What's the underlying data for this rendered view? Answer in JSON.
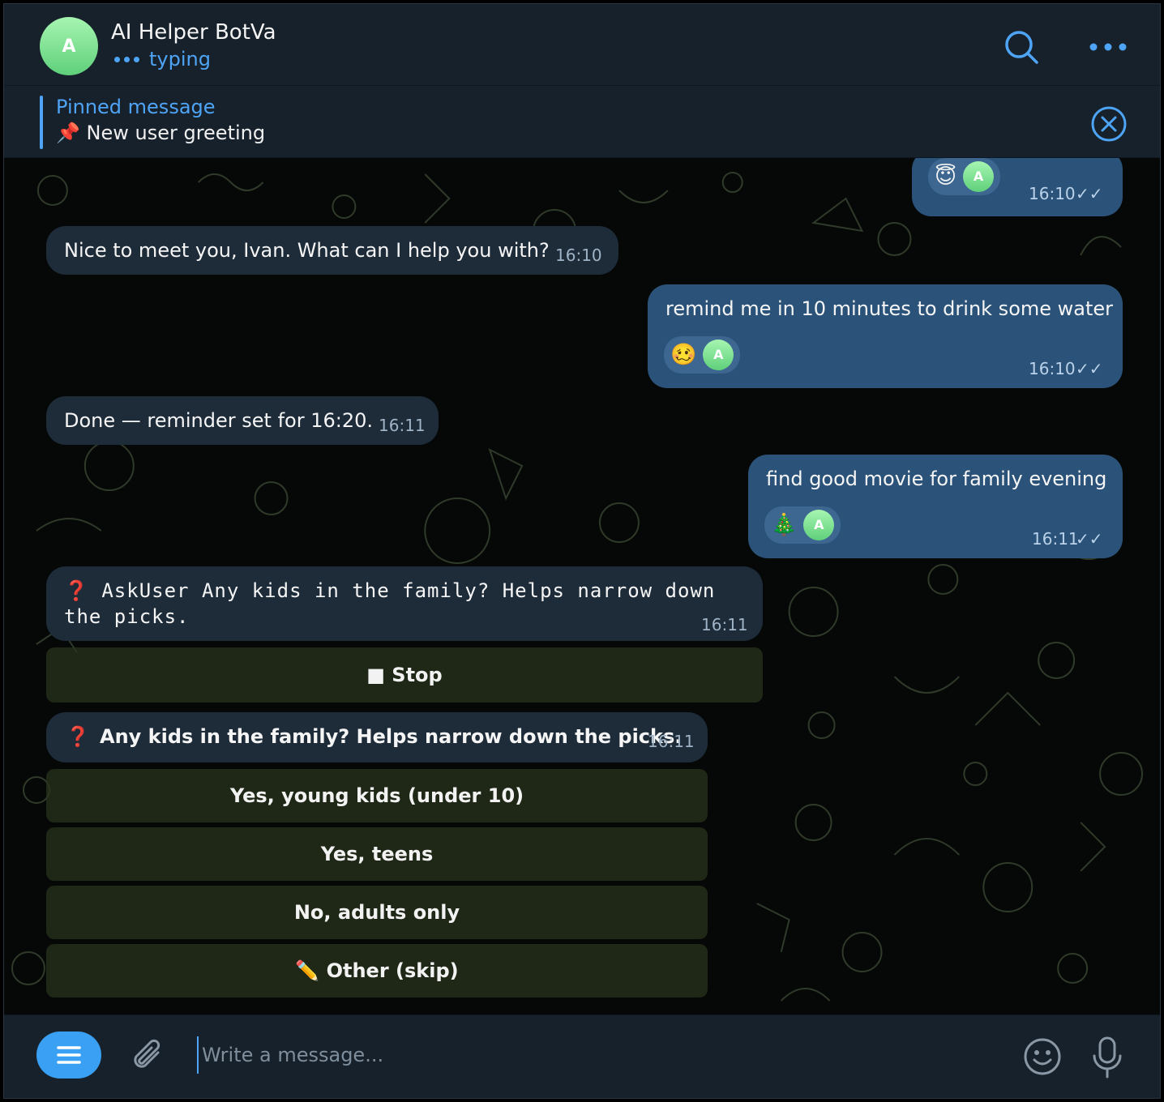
{
  "header": {
    "avatar_letter": "A",
    "title": "AI Helper BotVa",
    "status": "typing"
  },
  "pinned": {
    "title": "Pinned message",
    "text": "📌 New user greeting"
  },
  "messages": [
    {
      "dir": "out",
      "text": "",
      "reaction_emoji": "😇",
      "reaction_avatar": "A",
      "time": "16:10",
      "read": "✓✓"
    },
    {
      "dir": "in",
      "text": "Nice to meet you, Ivan. What can I help you with?",
      "time": "16:10"
    },
    {
      "dir": "out",
      "text": "remind me in 10 minutes to drink some water",
      "reaction_emoji": "🥴",
      "reaction_avatar": "A",
      "time": "16:10",
      "read": "✓✓"
    },
    {
      "dir": "in",
      "text": "Done — reminder set for 16:20.",
      "time": "16:11"
    },
    {
      "dir": "out",
      "text": "find good movie for family evening",
      "reaction_emoji": "🎄",
      "reaction_avatar": "A",
      "time": "16:11",
      "read": "✓✓"
    },
    {
      "dir": "in",
      "icon": "❓",
      "text": "AskUser Any kids in the family? Helps narrow down the picks.",
      "time": "16:11"
    },
    {
      "dir": "in",
      "icon": "❓",
      "text": "Any kids in the family? Helps narrow down the picks.",
      "time": "16:11"
    }
  ],
  "keyboards": {
    "stop": "■ Stop",
    "options": [
      "Yes, young kids (under 10)",
      "Yes, teens",
      "No, adults only",
      "✏️ Other (skip)"
    ]
  },
  "input": {
    "placeholder": "Write a message..."
  },
  "colors": {
    "accent": "#4ea4f6",
    "incoming": "#1e2c3a",
    "outgoing": "#2b5278",
    "panel": "#17212b"
  }
}
